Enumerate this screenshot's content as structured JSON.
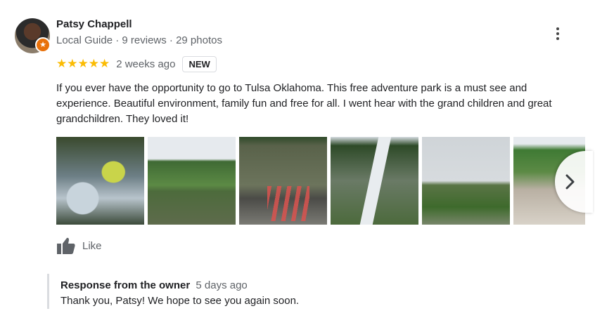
{
  "reviewer": {
    "name": "Patsy Chappell",
    "meta": "Local Guide · 9 reviews · 29 photos",
    "badge_icon": "local-guide-star-icon"
  },
  "review": {
    "stars": "★★★★★",
    "rating": 5,
    "date": "2 weeks ago",
    "badge": "NEW",
    "text": "If you ever have the opportunity to go to Tulsa Oklahoma. This free adventure park is a must see and experience. Beautiful environment, family fun and free for all. I went hear with the grand children and great grandchildren. They loved it!"
  },
  "actions": {
    "like_label": "Like"
  },
  "owner_response": {
    "title": "Response from the owner",
    "date": "5 days ago",
    "text": "Thank you, Patsy! We hope to see you again soon."
  },
  "colors": {
    "star": "#fbbc04",
    "guide_badge": "#e8710a"
  }
}
